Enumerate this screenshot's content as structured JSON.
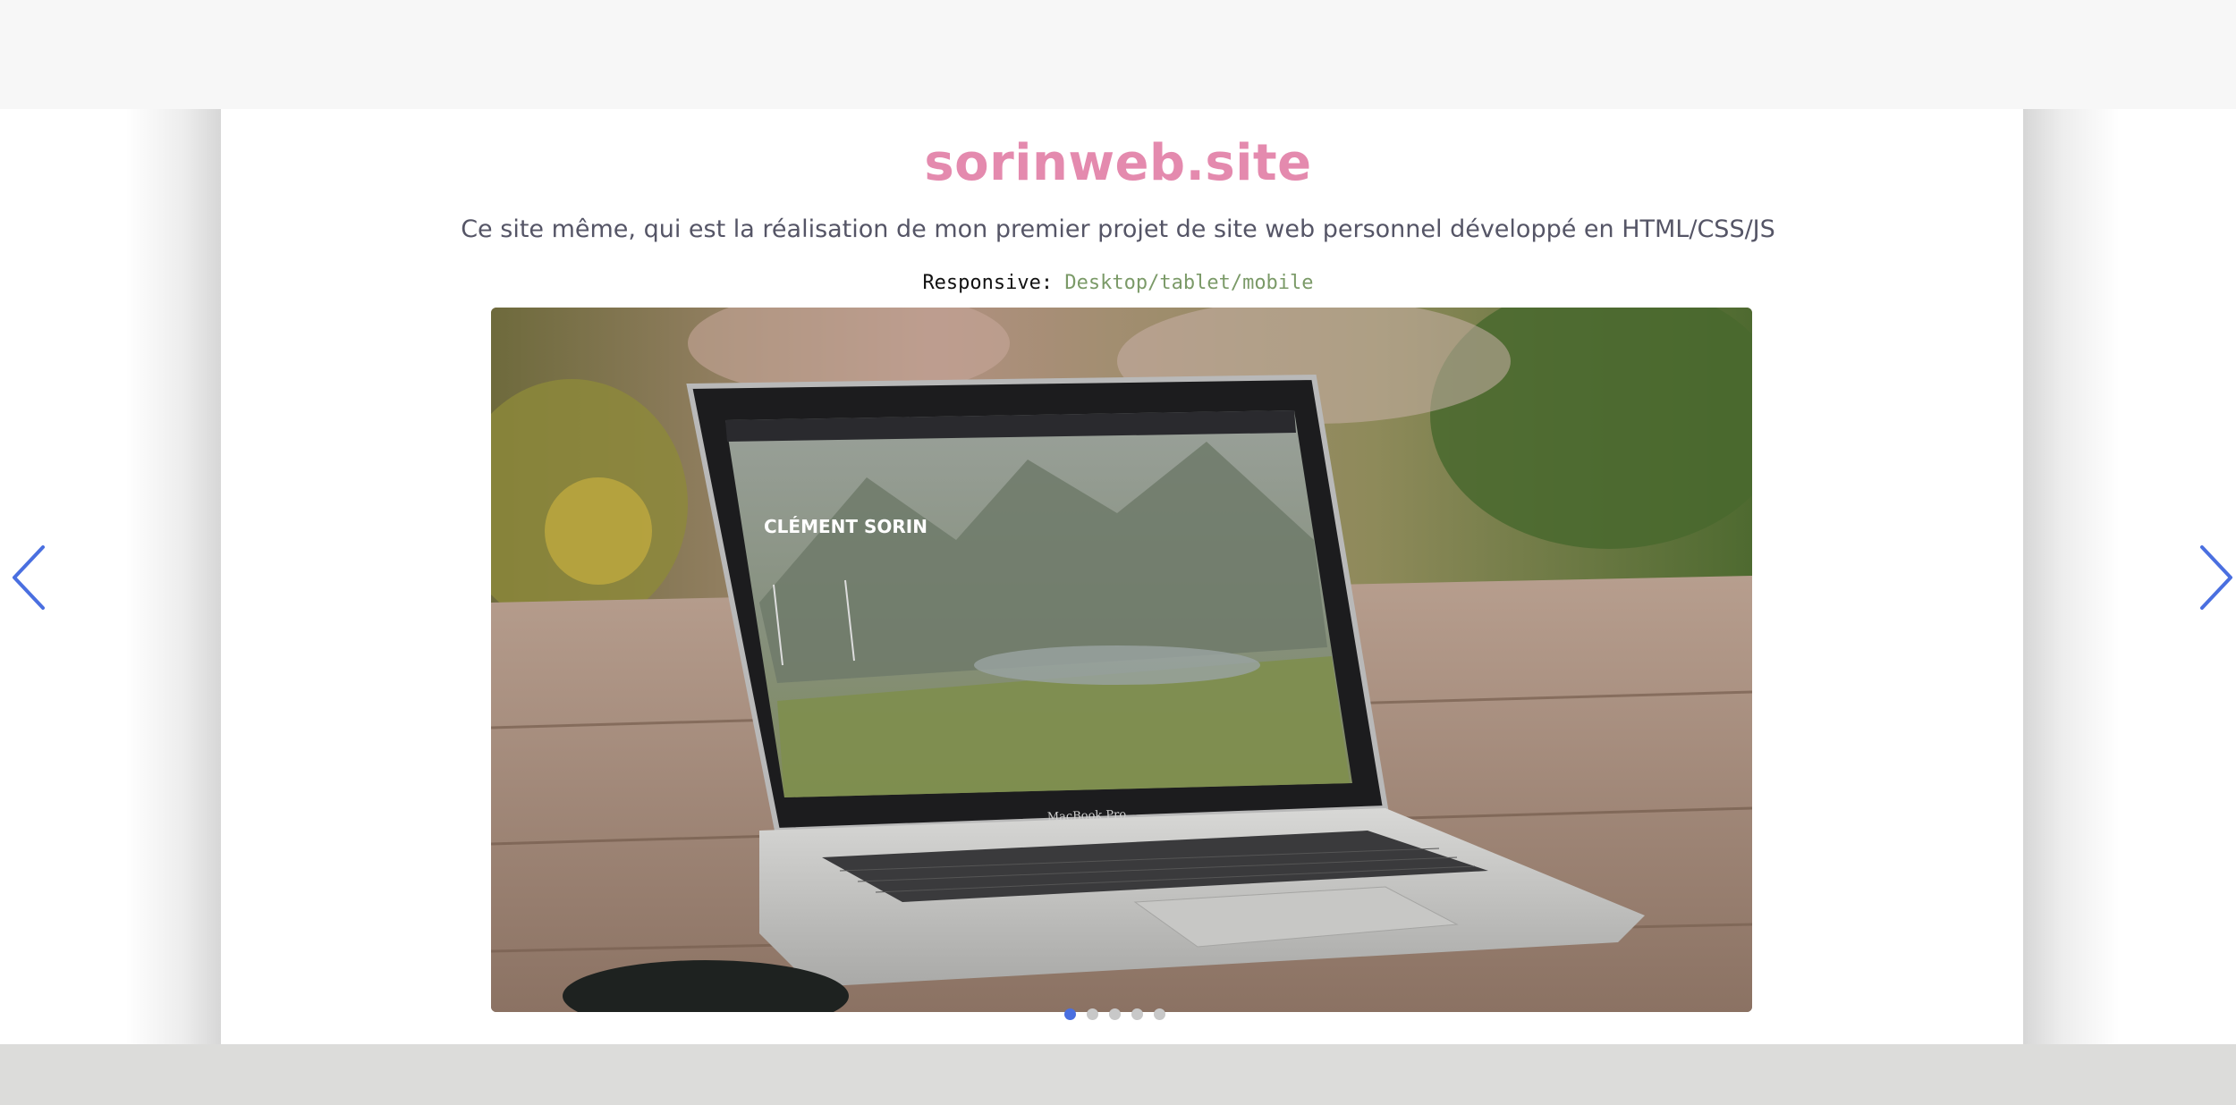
{
  "project": {
    "title": "sorinweb.site",
    "description": "Ce site même, qui est la réalisation de mon premier projet de site web personnel développé en HTML/CSS/JS",
    "responsive_label": "Responsive:",
    "responsive_value": "Desktop/tablet/mobile"
  },
  "photo": {
    "screen_heading": "CLÉMENT SORIN",
    "brand_label": "MacBook Pro"
  },
  "slider": {
    "slide_count": 5,
    "active_index": 0,
    "prev_icon": "chevron-left-icon",
    "next_icon": "chevron-right-icon"
  },
  "colors": {
    "title": "#e48aae",
    "accent": "#4a6fe0",
    "responsive_value": "#7b9a68"
  }
}
